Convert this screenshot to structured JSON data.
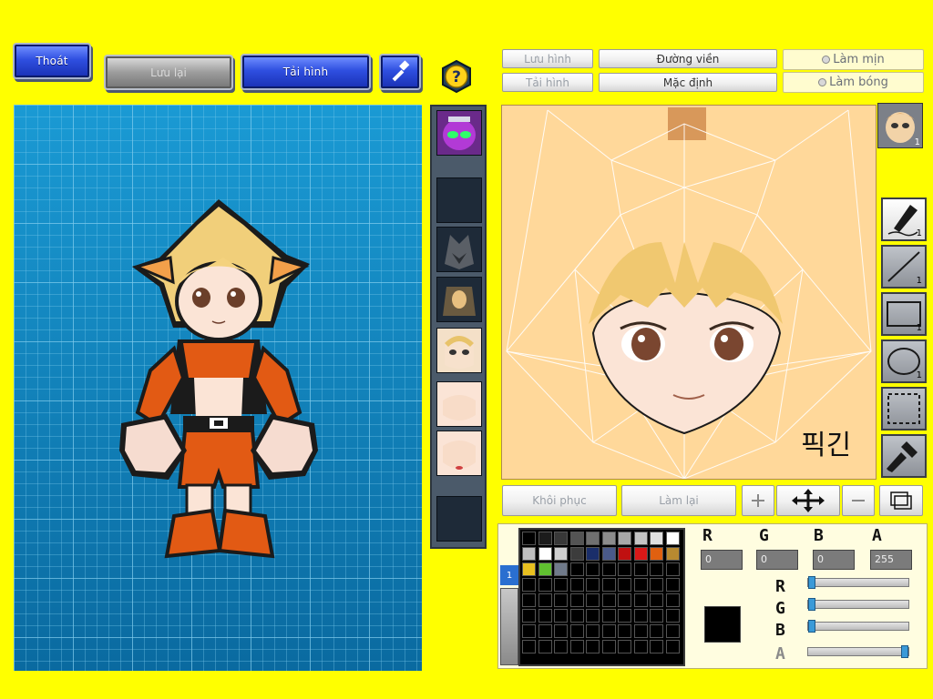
{
  "toolbar": {
    "exit_label": "Thoát",
    "save_label": "Lưu lại",
    "reload_label": "Tải hình",
    "hammer_icon": "hammer-icon",
    "help_icon": "question-icon"
  },
  "editor_tabs": {
    "save_image": "Lưu hình",
    "load_image": "Tải hình",
    "outline": "Đường viền",
    "default": "Mặc định",
    "smooth": "Làm mịn",
    "shade": "Làm bóng"
  },
  "face_overlay_text": "픽긴",
  "edit_actions": {
    "restore": "Khôi phục",
    "redo": "Làm lại"
  },
  "tools": [
    {
      "name": "pen",
      "count": "1"
    },
    {
      "name": "line",
      "count": "1"
    },
    {
      "name": "rectangle",
      "count": "1"
    },
    {
      "name": "ellipse",
      "count": "1"
    },
    {
      "name": "selection",
      "count": ""
    },
    {
      "name": "eyedropper",
      "count": ""
    }
  ],
  "avatar_badge": "1",
  "color": {
    "r_label": "R",
    "g_label": "G",
    "b_label": "B",
    "a_label": "A",
    "r": "0",
    "g": "0",
    "b": "0",
    "a": "255",
    "current": "#000000",
    "layer_tab": "1"
  },
  "palette": [
    "#000000",
    "#1c1c1c",
    "#383838",
    "#545454",
    "#707070",
    "#8c8c8c",
    "#a8a8a8",
    "#c4c4c4",
    "#e0e0e0",
    "#ffffff",
    "#bfbfbf",
    "#ffffff",
    "#cfcfcf",
    "#3c3c3c",
    "#1a2e6a",
    "#4a5a8a",
    "#c01010",
    "#d81818",
    "#e06010",
    "#b88a30",
    "#e8c020",
    "#60c030",
    "#707a8a"
  ]
}
